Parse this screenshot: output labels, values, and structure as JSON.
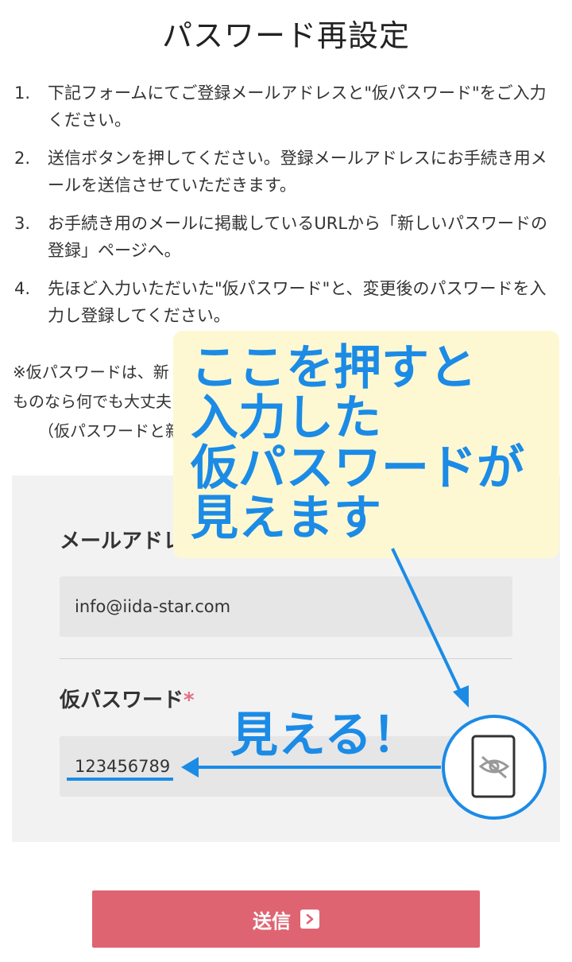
{
  "page": {
    "title": "パスワード再設定"
  },
  "steps": [
    {
      "num": "1.",
      "text": "下記フォームにてご登録メールアドレスと\"仮パスワード\"をご入力ください。"
    },
    {
      "num": "2.",
      "text": "送信ボタンを押してください。登録メールアドレスにお手続き用メールを送信させていただきます。"
    },
    {
      "num": "3.",
      "text": "お手続き用のメールに掲載しているURLから「新しいパスワードの登録」ページへ。"
    },
    {
      "num": "4.",
      "text": "先ほど入力いただいた\"仮パスワード\"と、変更後のパスワードを入力し登録してください。"
    }
  ],
  "note": {
    "line1": "※仮パスワードは、新",
    "line2": "ものなら何でも大丈夫",
    "line3": "（仮パスワードと新"
  },
  "form": {
    "email_label": "メールアドレス",
    "email_value": "info@iida-star.com",
    "password_label": "仮パスワード",
    "required_mark": "*",
    "password_value": "123456789",
    "toggle_icon": "eye-slash-icon"
  },
  "submit": {
    "label": "送信"
  },
  "annotation": {
    "callout_lines": [
      "ここを押すと",
      "入力した",
      "仮パスワードが",
      "見えます"
    ],
    "visible_label": "見える！",
    "color": "#1b8be6",
    "callout_bg": "#fdf8d2"
  },
  "colors": {
    "accent": "#df6472",
    "required": "#e07080",
    "panel_bg": "#f2f2f2",
    "field_bg": "#e6e6e6"
  }
}
